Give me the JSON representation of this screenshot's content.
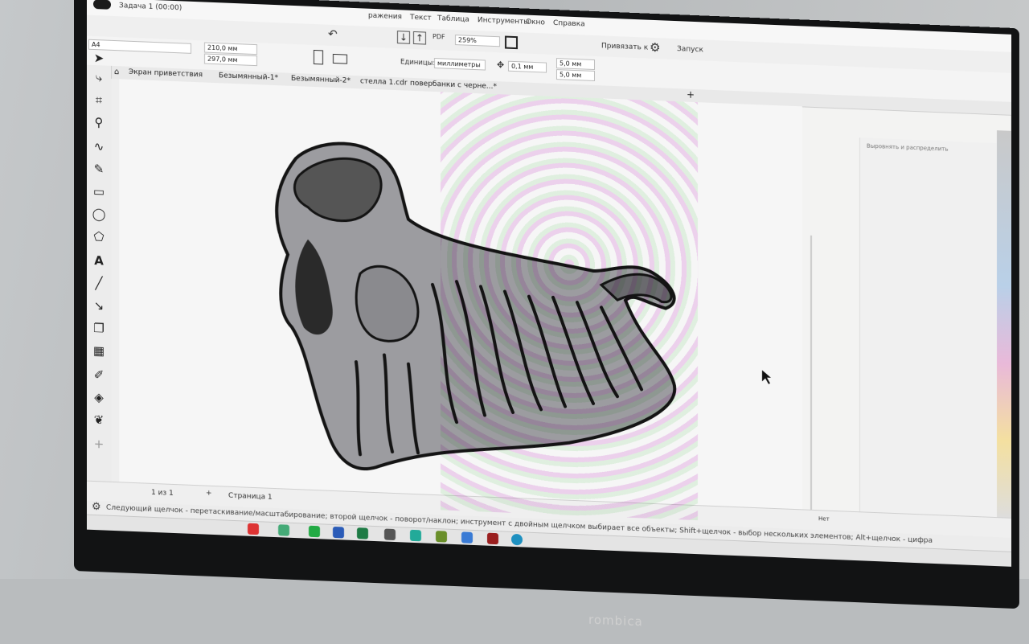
{
  "app": {
    "job_label": "Задача 1 (00:00)",
    "menu": [
      "ражения",
      "Текст",
      "Таблица",
      "Инструменты",
      "Окно",
      "Справка"
    ],
    "zoom": "259%",
    "snap_label": "Привязать к",
    "launch_label": "Запуск"
  },
  "propertybar": {
    "paper_size": "A4",
    "width": "210,0 мм",
    "height": "297,0 мм",
    "units_label": "Единицы:",
    "units_value": "миллиметры",
    "nudge": "0,1 мм",
    "dup_x": "5,0 мм",
    "dup_y": "5,0 мм"
  },
  "tabs": [
    "Экран приветствия",
    "Безымянный-1*",
    "Безымянный-2*",
    "стелла 1.cdr",
    "повербанки с черне...*"
  ],
  "docker": {
    "title": "Выровнять и распределить"
  },
  "status": {
    "page_info": "1 из 1",
    "page_tab": "Страница 1",
    "hint": "Следующий щелчок - перетаскивание/масштабирование; второй щелчок - поворот/наклон; инструмент с двойным щелчком выбирает все объекты; Shift+щелчок - выбор нескольких элементов; Alt+щелчок - цифра",
    "no_fill": "Нет"
  },
  "monitor_brand": "rombica",
  "colors": {
    "bezel": "#121314",
    "ui_bg": "#efefef",
    "artwork_fill": "#9c9ca0",
    "artwork_ink": "#141414"
  }
}
